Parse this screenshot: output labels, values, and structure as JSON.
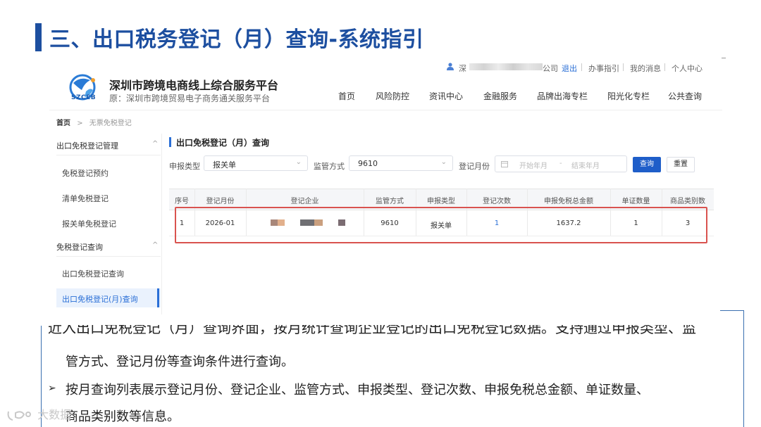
{
  "slide": {
    "title": "三、出口税务登记（月）查询-系统指引",
    "bullets": [
      "近入出口免税登记（月）查询界面，按月统计查询企业登记的出口免税登记数据。支持通过申报类型、监",
      "管方式、登记月份等查询条件进行查询。",
      "按月查询列表展示登记月份、登记企业、监管方式、申报类型、登记次数、申报免税总金额、单证数量、",
      "商品类别数等信息。"
    ],
    "watermark": "大数据"
  },
  "header": {
    "logo_text": "SZCEB",
    "title": "深圳市跨境电商线上综合服务平台",
    "subtitle": "原：深圳市跨境贸易电子商务通关服务平台",
    "user_prefix": "深",
    "user_suffix": "公司",
    "top_links": [
      "退出",
      "办事指引",
      "我的消息",
      "个人中心"
    ],
    "nav": [
      "首页",
      "风险防控",
      "资讯中心",
      "金融服务",
      "品牌出海专栏",
      "阳光化专栏",
      "公共查询"
    ]
  },
  "breadcrumb": {
    "home": "首页",
    "sep": ">",
    "current": "无票免税登记"
  },
  "sidebar": {
    "groups": [
      {
        "label": "出口免税登记管理",
        "items": [
          "免税登记预约",
          "清单免税登记",
          "报关单免税登记"
        ]
      },
      {
        "label": "免税登记查询",
        "items": [
          "出口免税登记查询",
          "出口免税登记(月)查询"
        ]
      }
    ]
  },
  "content": {
    "title": "出口免税登记（月）查询",
    "filters": {
      "declare_type_label": "申报类型",
      "declare_type_value": "报关单",
      "supervise_label": "监管方式",
      "supervise_value": "9610",
      "month_label": "登记月份",
      "month_start_placeholder": "开始年月",
      "month_sep": "-",
      "month_end_placeholder": "结束年月",
      "query_button": "查询",
      "reset_button": "重置"
    },
    "table": {
      "columns": [
        "序号",
        "登记月份",
        "登记企业",
        "监管方式",
        "申报类型",
        "登记次数",
        "申报免税总金额",
        "单证数量",
        "商品类别数"
      ],
      "rows": [
        {
          "index": "1",
          "month": "2026-01",
          "company": "",
          "supervise": "9610",
          "declare_type": "报关单",
          "count": "1",
          "amount": "1637.2",
          "docs": "1",
          "categories": "3"
        }
      ]
    }
  },
  "colors": {
    "accent": "#1d4fa0",
    "link": "#2a6fd6",
    "highlight": "#d9534f"
  }
}
